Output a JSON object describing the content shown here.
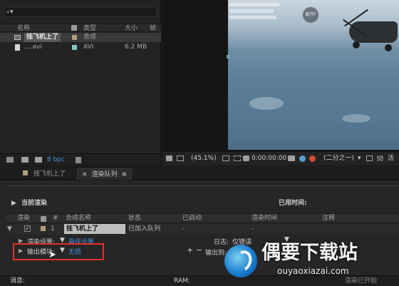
{
  "project": {
    "search_icon": "search-icon",
    "columns": {
      "name": "名称",
      "type": "类型",
      "size": "大小",
      "extra": "帧"
    },
    "items": [
      {
        "name": "挂飞机上了",
        "type": "合成",
        "size": "",
        "label_color": "#b0a07a",
        "selected": true
      },
      {
        "name": "....avi",
        "type": "AVI",
        "size": "6.2 MB",
        "label_color": "#7fc8c0",
        "selected": false
      }
    ],
    "footer_bpc": "8 bpc"
  },
  "viewer": {
    "overlay_button": "离开F",
    "toolbar": {
      "zoom": "(45.1%)",
      "timecode": "0:00:00:00",
      "resolution": "(二分之一)",
      "extra": "活"
    }
  },
  "tabs": [
    {
      "label": "挂飞机上了",
      "active": false
    },
    {
      "label": "渲染队列",
      "active": true
    }
  ],
  "render_queue": {
    "current_render": "当前渲染",
    "elapsed_label": "已用时间:",
    "columns": {
      "render": "渲染",
      "num": "#",
      "comp_name": "合成名称",
      "status": "状态",
      "started": "已启动",
      "render_time": "渲染时间",
      "comment": "注释"
    },
    "item": {
      "num": "1",
      "comp_name": "挂飞机上了",
      "status": "已加入队列",
      "started": "-",
      "render_time": "-"
    },
    "render_settings_label": "渲染设置:",
    "render_settings_value": "最佳设置",
    "output_module_label": "输出模块:",
    "output_module_value": "无损",
    "log_label": "日志:",
    "log_value": "仅错误",
    "output_to_label": "输出到:",
    "status_bar": {
      "message_label": "消息:",
      "ram_label": "RAM:",
      "right_text": "渲染已开始"
    }
  },
  "watermark": {
    "title": "偶要下载站",
    "url": "ouyaoxiazai.com"
  }
}
